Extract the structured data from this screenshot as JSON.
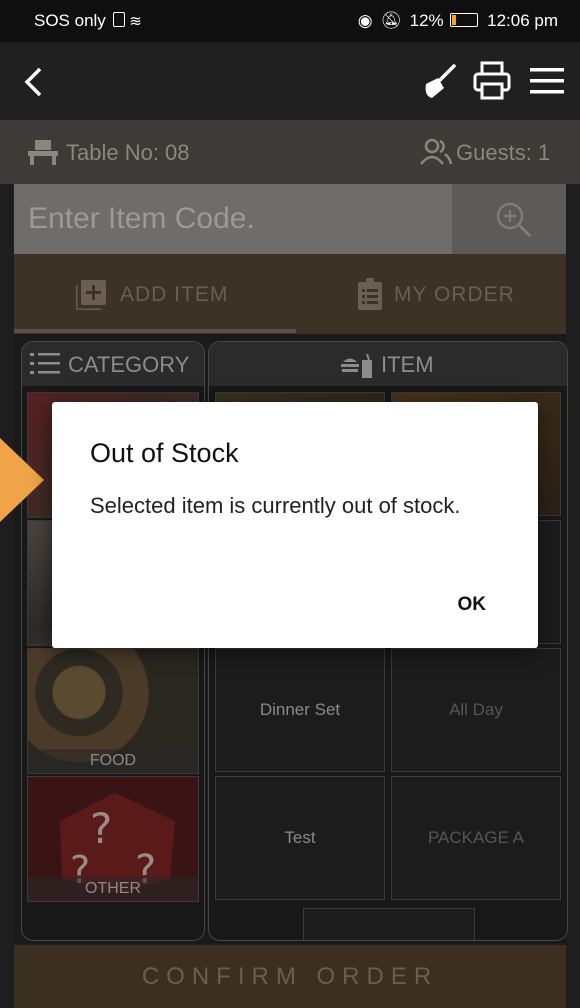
{
  "status_bar": {
    "carrier": "SOS only",
    "battery": "12%",
    "time": "12:06 pm"
  },
  "toolbar": {
    "back_icon": "chevron-left-icon",
    "icons": [
      "broom-icon",
      "printer-icon",
      "menu-icon"
    ]
  },
  "table_bar": {
    "table_label": "Table No: 08",
    "guests_label": "Guests: 1"
  },
  "search": {
    "placeholder": "Enter Item Code."
  },
  "tabs": [
    {
      "label": "ADD ITEM",
      "icon": "add-box-icon",
      "selected": true
    },
    {
      "label": "MY ORDER",
      "icon": "clipboard-icon",
      "selected": false
    }
  ],
  "category_panel": {
    "header": "CATEGORY",
    "items": [
      {
        "label": ""
      },
      {
        "label": ""
      },
      {
        "label": "FOOD"
      },
      {
        "label": "OTHER"
      }
    ]
  },
  "item_panel": {
    "header": "ITEM",
    "items": [
      {
        "label": ""
      },
      {
        "label": ""
      },
      {
        "label": ""
      },
      {
        "label": ""
      },
      {
        "label": "Dinner Set"
      },
      {
        "label": "All Day"
      },
      {
        "label": "Test"
      },
      {
        "label": "PACKAGE A"
      }
    ]
  },
  "confirm_button": "CONFIRM ORDER",
  "dialog": {
    "title": "Out of Stock",
    "message": "Selected item is currently out of stock.",
    "ok_label": "OK"
  },
  "colors": {
    "accent_brown": "#7b5d3c",
    "dialog_bg": "#ffffff",
    "pointer_orange": "#f0a347"
  }
}
